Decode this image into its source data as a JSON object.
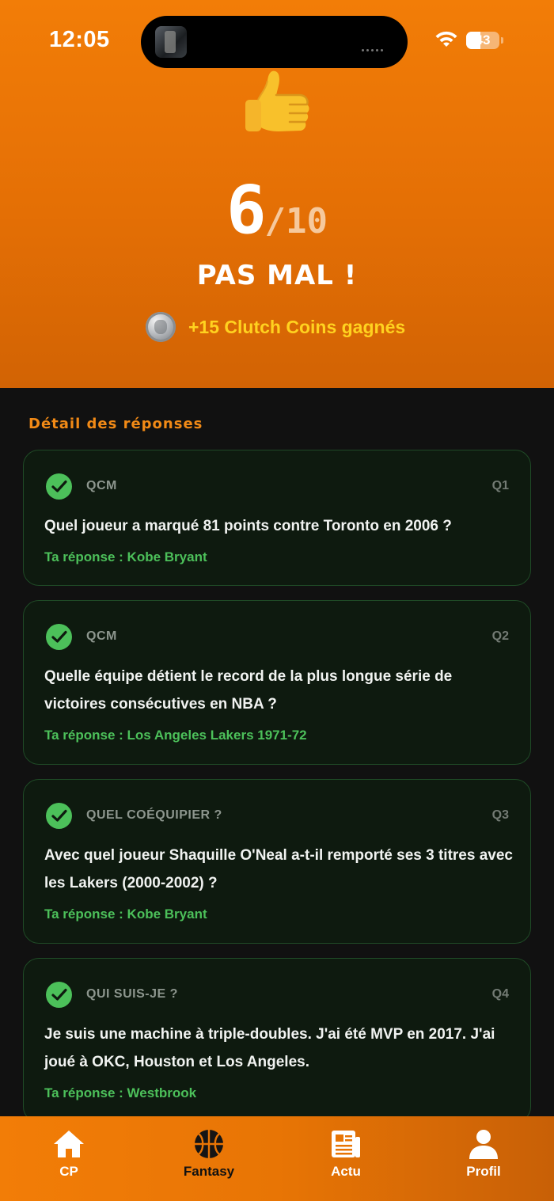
{
  "status_bar": {
    "time": "12:05",
    "battery": "43"
  },
  "result": {
    "score": "6",
    "total": "/10",
    "verdict": "PAS MAL !",
    "reward": "+15 Clutch Coins gagnés"
  },
  "details": {
    "title": "Détail des réponses",
    "answer_prefix": "Ta réponse : ",
    "questions": [
      {
        "type": "QCM",
        "number": "Q1",
        "text": "Quel joueur a marqué 81 points contre Toronto en 2006 ?",
        "answer": "Ta réponse : Kobe Bryant"
      },
      {
        "type": "QCM",
        "number": "Q2",
        "text": "Quelle équipe détient le record de la plus longue série de victoires consécutives en NBA ?",
        "answer": "Ta réponse : Los Angeles Lakers 1971-72"
      },
      {
        "type": "QUEL COÉQUIPIER ?",
        "number": "Q3",
        "text": "Avec quel joueur Shaquille O'Neal a-t-il remporté ses 3 titres avec les Lakers (2000-2002) ?",
        "answer": "Ta réponse : Kobe Bryant"
      },
      {
        "type": "QUI SUIS-JE ?",
        "number": "Q4",
        "text": "Je suis une machine à triple-doubles. J'ai été MVP en 2017. J'ai joué à OKC, Houston et Los Angeles.",
        "answer": "Ta réponse : Westbrook"
      }
    ]
  },
  "tabbar": {
    "items": [
      {
        "label": "CP",
        "icon": "home-icon"
      },
      {
        "label": "Fantasy",
        "icon": "basketball-icon",
        "active": true
      },
      {
        "label": "Actu",
        "icon": "newspaper-icon"
      },
      {
        "label": "Profil",
        "icon": "person-icon"
      }
    ]
  },
  "colors": {
    "accent": "#f27d07",
    "success": "#4cc05a",
    "coins": "#ffd21f",
    "card_bg": "#0e1a0f"
  }
}
